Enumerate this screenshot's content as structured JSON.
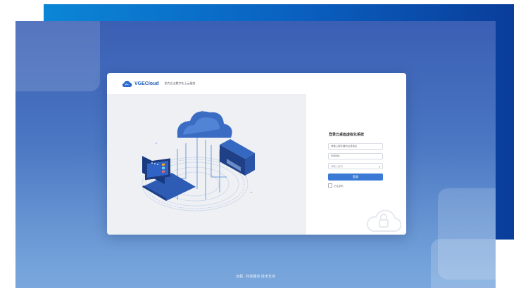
{
  "header": {
    "brand": "VGECloud",
    "tagline": "助力企业数字化上云服务"
  },
  "login": {
    "title": "登录云桌面虚拟化系统",
    "server_placeholder": "请输入服务器地址或域名",
    "username_value": "VGE001",
    "password_placeholder": "请输入密码",
    "login_button": "登录",
    "remember_label": "记住密码"
  },
  "footer": {
    "text": "远程 · 科技服务 技术支持"
  },
  "colors": {
    "accent": "#3a7ad6",
    "brand": "#1d5bb8",
    "background_top": "#3a5fb4",
    "background_bottom": "#7aa8dd"
  },
  "icons": [
    "cloud-logo-icon",
    "chevron-down-icon",
    "cloud-lock-icon",
    "checkbox"
  ]
}
